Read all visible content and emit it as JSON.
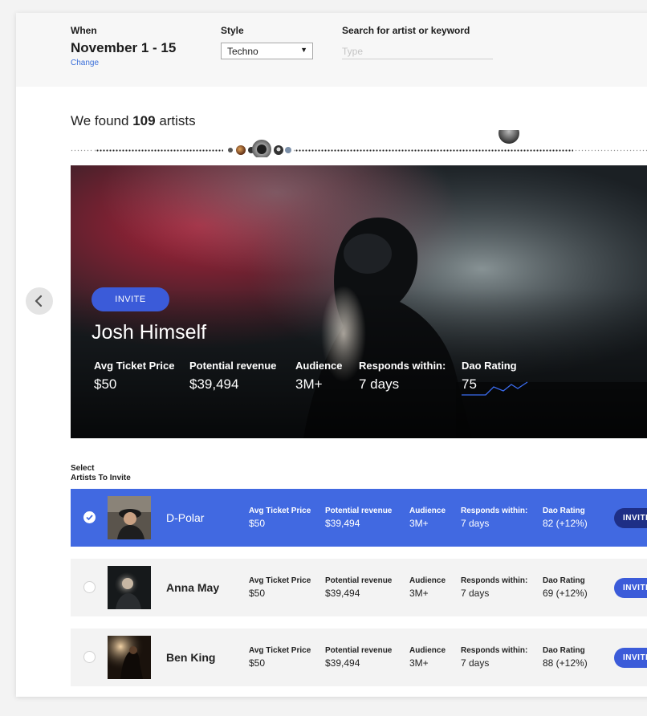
{
  "filters": {
    "when": {
      "label": "When",
      "value": "November 1 - 15",
      "change_link": "Change"
    },
    "style": {
      "label": "Style",
      "selected": "Techno"
    },
    "search": {
      "label": "Search for artist or keyword",
      "placeholder": "Type",
      "value": ""
    }
  },
  "results": {
    "prefix": "We found",
    "count": "109",
    "suffix": "artists"
  },
  "featured": {
    "invite_label": "INVITE",
    "name": "Josh Himself",
    "stats": [
      {
        "label": "Avg Ticket Price",
        "value": "$50"
      },
      {
        "label": "Potential revenue",
        "value": "$39,494"
      },
      {
        "label": "Audience",
        "value": "3M+"
      },
      {
        "label": "Responds within:",
        "value": "7 days"
      },
      {
        "label": "Dao Rating",
        "value": "75"
      }
    ]
  },
  "select_section": {
    "line1": "Select",
    "line2": "Artists To Invite"
  },
  "artists": [
    {
      "name": "D-Polar",
      "selected": true,
      "invite_label": "INVITE",
      "stats": [
        {
          "label": "Avg Ticket Price",
          "value": "$50"
        },
        {
          "label": "Potential revenue",
          "value": "$39,494"
        },
        {
          "label": "Audience",
          "value": "3M+"
        },
        {
          "label": "Responds within:",
          "value": "7 days"
        },
        {
          "label": "Dao Rating",
          "value": "82 (+12%)"
        }
      ]
    },
    {
      "name": "Anna May",
      "selected": false,
      "invite_label": "INVITE",
      "stats": [
        {
          "label": "Avg Ticket Price",
          "value": "$50"
        },
        {
          "label": "Potential revenue",
          "value": "$39,494"
        },
        {
          "label": "Audience",
          "value": "3M+"
        },
        {
          "label": "Responds within:",
          "value": "7 days"
        },
        {
          "label": "Dao Rating",
          "value": "69 (+12%)"
        }
      ]
    },
    {
      "name": "Ben King",
      "selected": false,
      "invite_label": "INVITE",
      "stats": [
        {
          "label": "Avg Ticket Price",
          "value": "$50"
        },
        {
          "label": "Potential revenue",
          "value": "$39,494"
        },
        {
          "label": "Audience",
          "value": "3M+"
        },
        {
          "label": "Responds within:",
          "value": "7 days"
        },
        {
          "label": "Dao Rating",
          "value": "88 (+12%)"
        }
      ]
    }
  ],
  "colors": {
    "accent": "#4169e1",
    "button": "#3b5bd9",
    "button_dark": "#1e2f86",
    "link": "#3a6fd9",
    "row_bg": "#f3f3f3"
  },
  "icons": [
    "chevron-left-icon",
    "check-icon",
    "dropdown-caret-icon",
    "sparkline-icon"
  ]
}
